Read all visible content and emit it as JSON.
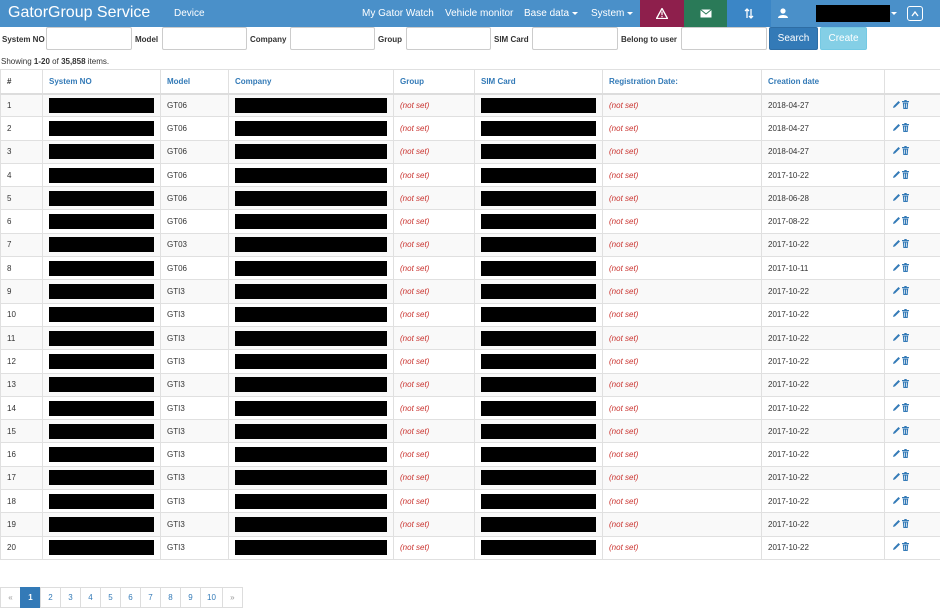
{
  "navbar": {
    "brand": "GatorGroup Service",
    "device_label": "Device",
    "my_gator_watch": "My Gator Watch",
    "vehicle_monitor": "Vehicle monitor",
    "base_data": "Base data",
    "system": "System",
    "tile_icons": [
      "warning-icon",
      "mail-icon",
      "sort-icon"
    ],
    "accent": "#4a90c9"
  },
  "filter": {
    "system_no": "System NO",
    "model": "Model",
    "company": "Company",
    "group": "Group",
    "sim_card": "SIM Card",
    "belong_to_user": "Belong to user",
    "search": "Search",
    "create": "Create"
  },
  "summary": {
    "prefix": "Showing ",
    "range": "1-20",
    "middle": " of ",
    "total": "35,858",
    "suffix": " items."
  },
  "table": {
    "headers": {
      "hash": "#",
      "system_no": "System NO",
      "model": "Model",
      "company": "Company",
      "group": "Group",
      "sim_card": "SIM Card",
      "registration_date": "Registration Date:",
      "creation_date": "Creation date"
    },
    "rows": [
      {
        "num": "1",
        "model": "GT06",
        "group": "(not set)",
        "reg": "(not set)",
        "created": "2018-04-27"
      },
      {
        "num": "2",
        "model": "GT06",
        "group": "(not set)",
        "reg": "(not set)",
        "created": "2018-04-27"
      },
      {
        "num": "3",
        "model": "GT06",
        "group": "(not set)",
        "reg": "(not set)",
        "created": "2018-04-27"
      },
      {
        "num": "4",
        "model": "GT06",
        "group": "(not set)",
        "reg": "(not set)",
        "created": "2017-10-22"
      },
      {
        "num": "5",
        "model": "GT06",
        "group": "(not set)",
        "reg": "(not set)",
        "created": "2018-06-28"
      },
      {
        "num": "6",
        "model": "GT06",
        "group": "(not set)",
        "reg": "(not set)",
        "created": "2017-08-22"
      },
      {
        "num": "7",
        "model": "GT03",
        "group": "(not set)",
        "reg": "(not set)",
        "created": "2017-10-22"
      },
      {
        "num": "8",
        "model": "GT06",
        "group": "(not set)",
        "reg": "(not set)",
        "created": "2017-10-11"
      },
      {
        "num": "9",
        "model": "GTI3",
        "group": "(not set)",
        "reg": "(not set)",
        "created": "2017-10-22"
      },
      {
        "num": "10",
        "model": "GTI3",
        "group": "(not set)",
        "reg": "(not set)",
        "created": "2017-10-22"
      },
      {
        "num": "11",
        "model": "GTI3",
        "group": "(not set)",
        "reg": "(not set)",
        "created": "2017-10-22"
      },
      {
        "num": "12",
        "model": "GTI3",
        "group": "(not set)",
        "reg": "(not set)",
        "created": "2017-10-22"
      },
      {
        "num": "13",
        "model": "GTI3",
        "group": "(not set)",
        "reg": "(not set)",
        "created": "2017-10-22"
      },
      {
        "num": "14",
        "model": "GTI3",
        "group": "(not set)",
        "reg": "(not set)",
        "created": "2017-10-22"
      },
      {
        "num": "15",
        "model": "GTI3",
        "group": "(not set)",
        "reg": "(not set)",
        "created": "2017-10-22"
      },
      {
        "num": "16",
        "model": "GTI3",
        "group": "(not set)",
        "reg": "(not set)",
        "created": "2017-10-22"
      },
      {
        "num": "17",
        "model": "GTI3",
        "group": "(not set)",
        "reg": "(not set)",
        "created": "2017-10-22"
      },
      {
        "num": "18",
        "model": "GTI3",
        "group": "(not set)",
        "reg": "(not set)",
        "created": "2017-10-22"
      },
      {
        "num": "19",
        "model": "GTI3",
        "group": "(not set)",
        "reg": "(not set)",
        "created": "2017-10-22"
      },
      {
        "num": "20",
        "model": "GTI3",
        "group": "(not set)",
        "reg": "(not set)",
        "created": "2017-10-22"
      }
    ]
  },
  "pagination": {
    "prev": "«",
    "next": "»",
    "pages": [
      "1",
      "2",
      "3",
      "4",
      "5",
      "6",
      "7",
      "8",
      "9",
      "10"
    ],
    "active": "1"
  }
}
